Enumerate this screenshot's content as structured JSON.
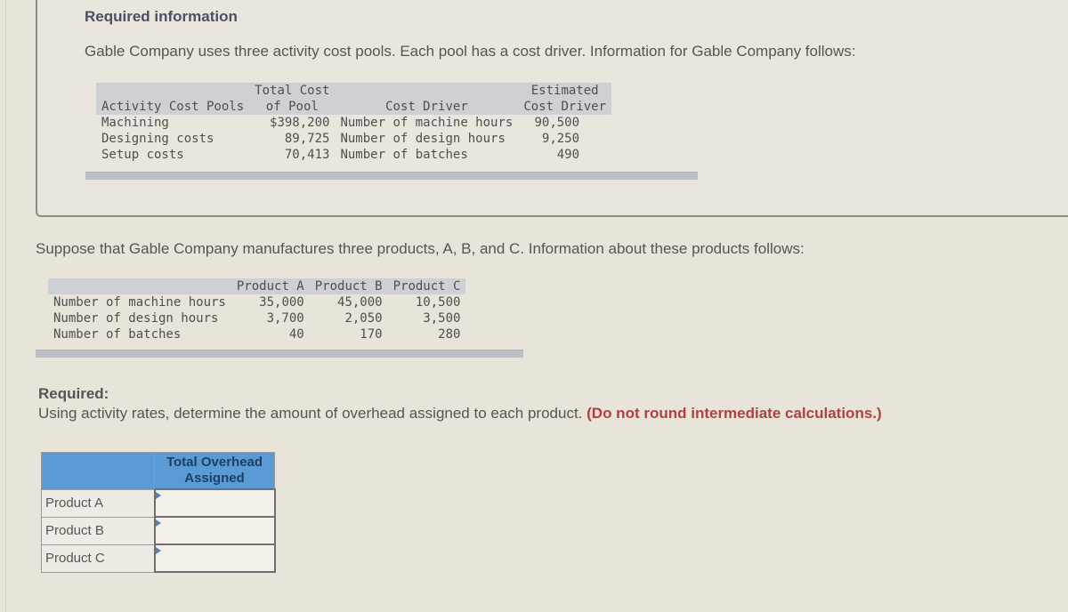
{
  "header": {
    "title": "Required information",
    "intro": "Gable Company uses three activity cost pools. Each pool has a cost driver. Information for Gable Company follows:"
  },
  "pool_table": {
    "headers": {
      "pools": "Activity Cost Pools",
      "total_cost_line1": "Total Cost",
      "total_cost_line2": "of Pool",
      "driver": "Cost Driver",
      "estimated_line1": "Estimated",
      "estimated_line2": "Cost Driver"
    },
    "rows": [
      {
        "pool": "Machining",
        "cost": "$398,200",
        "driver": "Number of machine hours",
        "estimate": "90,500"
      },
      {
        "pool": "Designing costs",
        "cost": "89,725",
        "driver": "Number of design hours",
        "estimate": "9,250"
      },
      {
        "pool": "Setup costs",
        "cost": "70,413",
        "driver": "Number of batches",
        "estimate": "490"
      }
    ]
  },
  "products_intro": "Suppose that Gable Company manufactures three products, A, B, and C. Information about these products follows:",
  "product_table": {
    "headers": [
      "Product A",
      "Product B",
      "Product C"
    ],
    "rows": [
      {
        "label": "Number of machine hours",
        "values": [
          "35,000",
          "45,000",
          "10,500"
        ]
      },
      {
        "label": "Number of design hours",
        "values": [
          "3,700",
          "2,050",
          "3,500"
        ]
      },
      {
        "label": "Number of batches",
        "values": [
          "40",
          "170",
          "280"
        ]
      }
    ]
  },
  "required": {
    "label": "Required:",
    "text": "Using activity rates, determine the amount of overhead assigned to each product.",
    "note": "(Do not round intermediate calculations.)"
  },
  "answer_table": {
    "header_line1": "Total Overhead",
    "header_line2": "Assigned",
    "rows": [
      {
        "label": "Product A",
        "value": ""
      },
      {
        "label": "Product B",
        "value": ""
      },
      {
        "label": "Product C",
        "value": ""
      }
    ]
  },
  "colors": {
    "answer_header_bg": "#5b9bd5",
    "note_red": "#b04141",
    "table_header_gray": "#cfd0d6"
  }
}
